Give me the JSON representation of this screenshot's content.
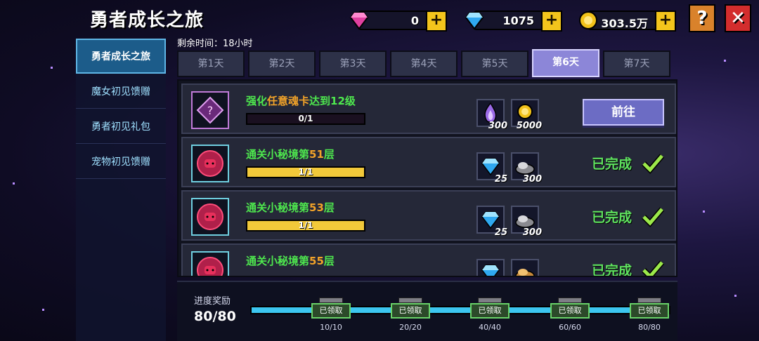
{
  "header": {
    "title": "勇者成长之旅",
    "help": "?",
    "close": "✕"
  },
  "currency": [
    {
      "icon": "purple-gem-icon",
      "value": "0"
    },
    {
      "icon": "blue-diamond-icon",
      "value": "1075"
    },
    {
      "icon": "gold-coin-icon",
      "value": "303.5万"
    }
  ],
  "plus": "+",
  "sidebar": [
    {
      "label": "勇者成长之旅",
      "active": true
    },
    {
      "label": "魔女初见馈赠",
      "active": false
    },
    {
      "label": "勇者初见礼包",
      "active": false
    },
    {
      "label": "宠物初见馈赠",
      "active": false
    }
  ],
  "remaining": "剩余时间：18小时",
  "tabs": [
    "第1天",
    "第2天",
    "第3天",
    "第4天",
    "第5天",
    "第6天",
    "第7天"
  ],
  "active_tab": 5,
  "tasks": [
    {
      "pre": "强化",
      "hl": "任意魂卡",
      "post": "达到12级",
      "progress": "0/1",
      "fraction": 0,
      "rewards": [
        {
          "icon": "purple-flame-icon",
          "count": "300"
        },
        {
          "icon": "gold-coin-icon",
          "count": "5000"
        }
      ],
      "action": "前往"
    },
    {
      "pre": "通关小秘境第",
      "hl": "51",
      "post": "层",
      "progress": "1/1",
      "fraction": 1,
      "rewards": [
        {
          "icon": "blue-diamond-icon",
          "count": "25"
        },
        {
          "icon": "ore-icon",
          "count": "300"
        }
      ],
      "status": "已完成"
    },
    {
      "pre": "通关小秘境第",
      "hl": "53",
      "post": "层",
      "progress": "1/1",
      "fraction": 1,
      "rewards": [
        {
          "icon": "blue-diamond-icon",
          "count": "25"
        },
        {
          "icon": "ore-icon",
          "count": "300"
        }
      ],
      "status": "已完成"
    },
    {
      "pre": "通关小秘境第",
      "hl": "55",
      "post": "层",
      "progress": "",
      "fraction": 1,
      "rewards": [
        {
          "icon": "blue-diamond-icon",
          "count": ""
        },
        {
          "icon": "gold-ore-icon",
          "count": ""
        }
      ],
      "status": "已完成"
    }
  ],
  "bottom": {
    "label": "进度奖励",
    "value": "80/80",
    "milestones": [
      {
        "claimed": "已领取",
        "value": "10/10"
      },
      {
        "claimed": "已领取",
        "value": "20/20"
      },
      {
        "claimed": "已领取",
        "value": "40/40"
      },
      {
        "claimed": "已领取",
        "value": "60/60"
      },
      {
        "claimed": "已领取",
        "value": "80/80"
      }
    ]
  }
}
